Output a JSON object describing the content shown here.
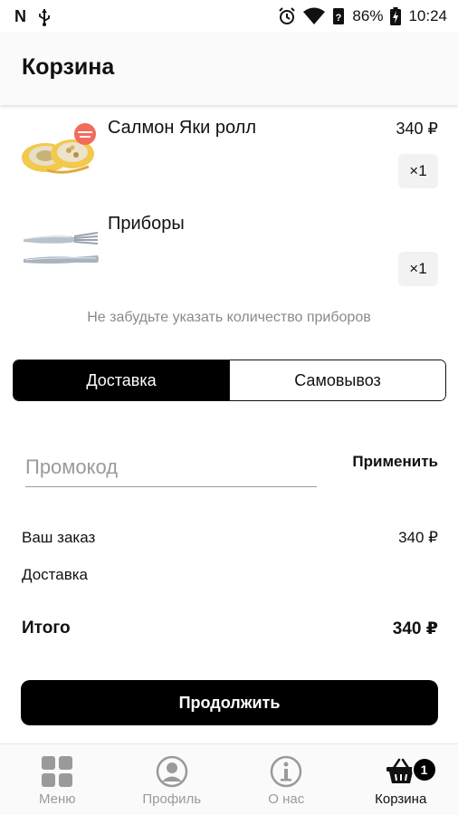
{
  "status_bar": {
    "battery": "86%",
    "time": "10:24",
    "icons": [
      "n-icon",
      "usb-icon",
      "alarm-icon",
      "wifi-icon",
      "signal-icon",
      "battery-icon"
    ]
  },
  "header": {
    "title": "Корзина"
  },
  "cart": {
    "items": [
      {
        "name": "Салмон Яки ролл",
        "price": "340 ₽",
        "qty": "×1",
        "image": "sushi-roll"
      },
      {
        "name": "Приборы",
        "price": "",
        "qty": "×1",
        "image": "cutlery"
      }
    ],
    "reminder": "Не забудьте указать количество приборов"
  },
  "delivery_toggle": {
    "options": [
      "Доставка",
      "Самовывоз"
    ],
    "selected": "Доставка"
  },
  "promo": {
    "placeholder": "Промокод",
    "value": "",
    "apply_label": "Применить"
  },
  "summary": {
    "order_label": "Ваш заказ",
    "order_value": "340 ₽",
    "delivery_label": "Доставка",
    "delivery_value": "",
    "total_label": "Итого",
    "total_value": "340 ₽"
  },
  "continue_label": "Продолжить",
  "bottom_nav": {
    "items": [
      {
        "label": "Меню",
        "icon": "grid-icon"
      },
      {
        "label": "Профиль",
        "icon": "profile-icon"
      },
      {
        "label": "О нас",
        "icon": "info-icon"
      },
      {
        "label": "Корзина",
        "icon": "basket-icon"
      }
    ],
    "active": "Корзина",
    "cart_badge": "1"
  },
  "colors": {
    "accent": "#000000",
    "muted": "#9a9a9a",
    "badge_red": "#f26b5b",
    "roll_yellow": "#f2c94c"
  }
}
